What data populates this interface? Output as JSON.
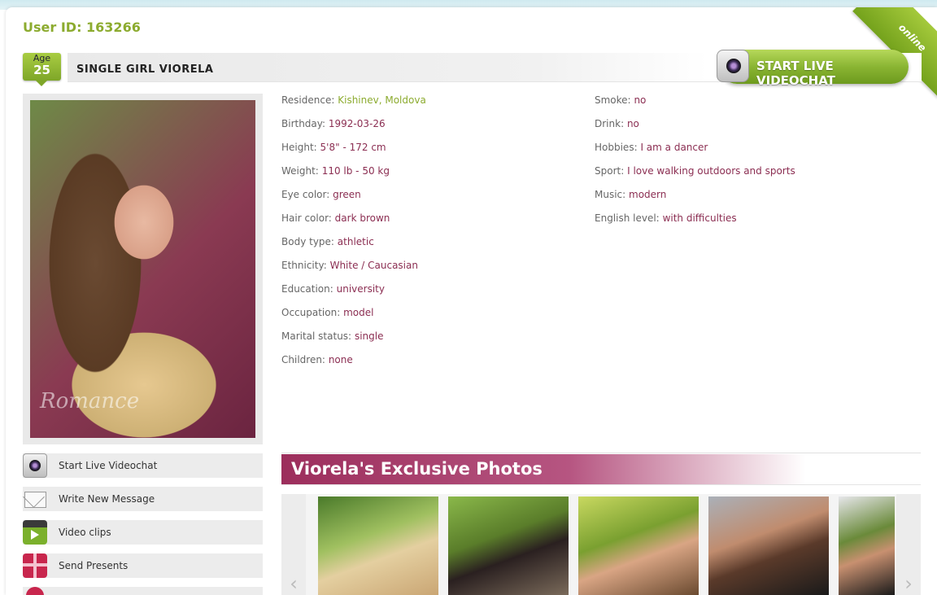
{
  "user_id_text": "User ID: 163266",
  "status_ribbon": "online",
  "age": {
    "label": "Age",
    "value": "25"
  },
  "profile_title": "SINGLE GIRL VIORELA",
  "videochat_button": "START LIVE VIDEOCHAT",
  "photo_watermark": "Romance",
  "details_left": [
    {
      "key": "Residence:",
      "value": "Kishinev, Moldova"
    },
    {
      "key": "Birthday:",
      "value": "1992-03-26"
    },
    {
      "key": "Height:",
      "value": "5'8\" - 172 cm"
    },
    {
      "key": "Weight:",
      "value": "110 lb - 50 kg"
    },
    {
      "key": "Eye color:",
      "value": "green"
    },
    {
      "key": "Hair color:",
      "value": "dark brown"
    },
    {
      "key": "Body type:",
      "value": "athletic"
    },
    {
      "key": "Ethnicity:",
      "value": "White / Caucasian"
    },
    {
      "key": "Education:",
      "value": "university"
    },
    {
      "key": "Occupation:",
      "value": "model"
    },
    {
      "key": "Marital status:",
      "value": "single"
    },
    {
      "key": "Children:",
      "value": "none"
    }
  ],
  "details_right": [
    {
      "key": "Smoke:",
      "value": "no"
    },
    {
      "key": "Drink:",
      "value": "no"
    },
    {
      "key": "Hobbies:",
      "value": "I am a dancer"
    },
    {
      "key": "Sport:",
      "value": "I love walking outdoors and sports"
    },
    {
      "key": "Music:",
      "value": "modern"
    },
    {
      "key": "English level:",
      "value": "with difficulties"
    }
  ],
  "actions": [
    {
      "label": "Start Live Videochat",
      "icon": "webcam-icon"
    },
    {
      "label": "Write New Message",
      "icon": "envelope-icon"
    },
    {
      "label": "Video clips",
      "icon": "clapperboard-icon"
    },
    {
      "label": "Send Presents",
      "icon": "gift-icon"
    }
  ],
  "exclusive_title": "Viorela's Exclusive Photos",
  "gallery": {
    "prev": "‹",
    "next": "›"
  },
  "colors": {
    "accent_green": "#8cab2f",
    "value_text": "#8b2e52",
    "exclusive_bar": "#9c2e5c"
  }
}
